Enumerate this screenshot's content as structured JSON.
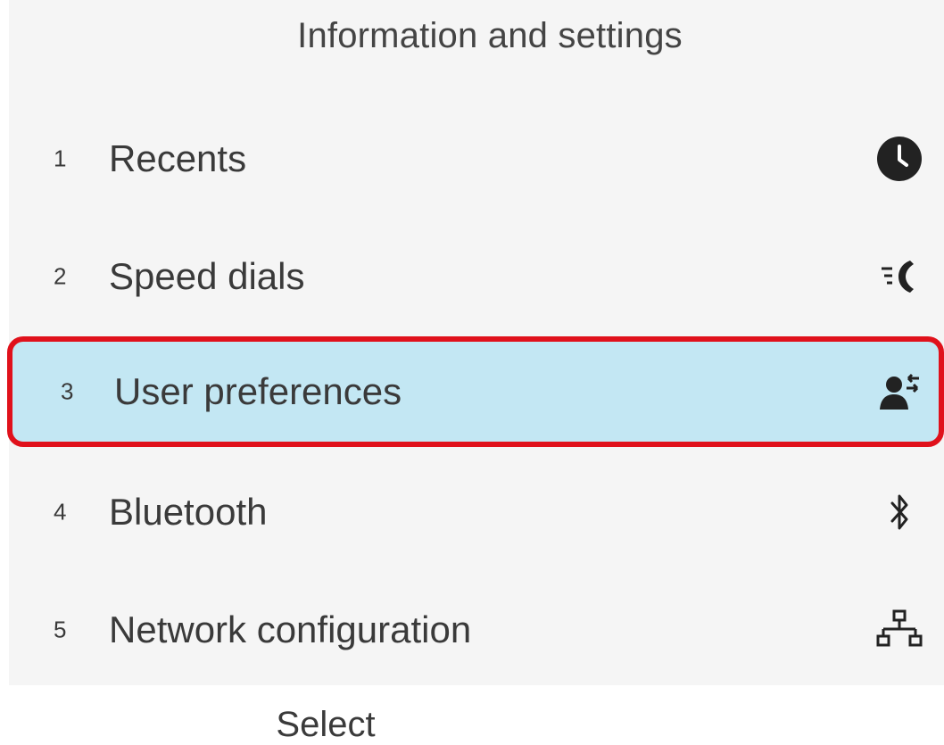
{
  "header": {
    "title": "Information and settings"
  },
  "menu": {
    "items": [
      {
        "number": "1",
        "label": "Recents",
        "icon": "clock-icon"
      },
      {
        "number": "2",
        "label": "Speed dials",
        "icon": "speed-dial-icon"
      },
      {
        "number": "3",
        "label": "User preferences",
        "icon": "user-preferences-icon",
        "selected": true
      },
      {
        "number": "4",
        "label": "Bluetooth",
        "icon": "bluetooth-icon"
      },
      {
        "number": "5",
        "label": "Network configuration",
        "icon": "network-icon"
      }
    ]
  },
  "softkeys": {
    "select_label": "Select"
  },
  "colors": {
    "highlight_bg": "#c3e7f3",
    "selection_border": "#e0111b",
    "screen_bg": "#f5f5f5"
  }
}
